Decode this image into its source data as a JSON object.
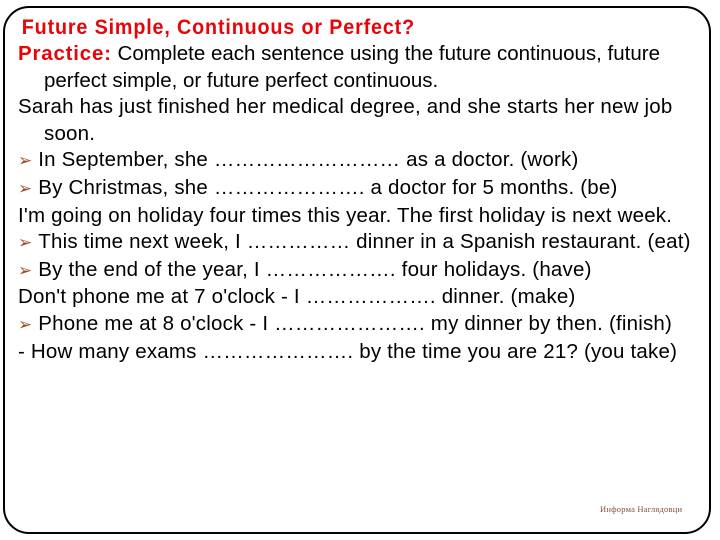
{
  "slide": {
    "title": "Future Simple, Continuous or Perfect?",
    "practice_label": "Practice:",
    "practice_text": " Complete each sentence using the future continuous, future perfect simple, or future perfect continuous.",
    "bullet_glyph": "➢",
    "title_color": "#E8050A",
    "bullet_color": "#9C4A22",
    "text_color": "#000000",
    "watermark": "Информа Наглядовци"
  },
  "lines": [
    {
      "id": "context-1",
      "type": "plain",
      "text": "Sarah has just finished her medical degree, and she starts her new job soon."
    },
    {
      "id": "item-work",
      "type": "bullet",
      "text": "In September, she ……………………… as a doctor. (work)"
    },
    {
      "id": "item-be",
      "type": "bullet",
      "text": "By Christmas, she …………………. a doctor for 5 months. (be)"
    },
    {
      "id": "context-2",
      "type": "plain",
      "text": "I'm going on holiday four times this year. The first holiday is next week."
    },
    {
      "id": "item-eat",
      "type": "bullet",
      "text": "This time next week, I …………… dinner in a Spanish restaurant. (eat)"
    },
    {
      "id": "item-have",
      "type": "bullet",
      "text": "By the end of the year, I ………………. four holidays. (have)"
    },
    {
      "id": "context-3",
      "type": "plain",
      "text": "Don't phone me at 7 o'clock - I ………………. dinner. (make)"
    },
    {
      "id": "item-finish",
      "type": "bullet",
      "text": "Phone me at 8 o'clock - I …………………. my dinner by then. (finish)"
    },
    {
      "id": "item-you-take",
      "type": "plain",
      "text": "- How many exams …………………. by the time you are 21? (you take)"
    }
  ]
}
